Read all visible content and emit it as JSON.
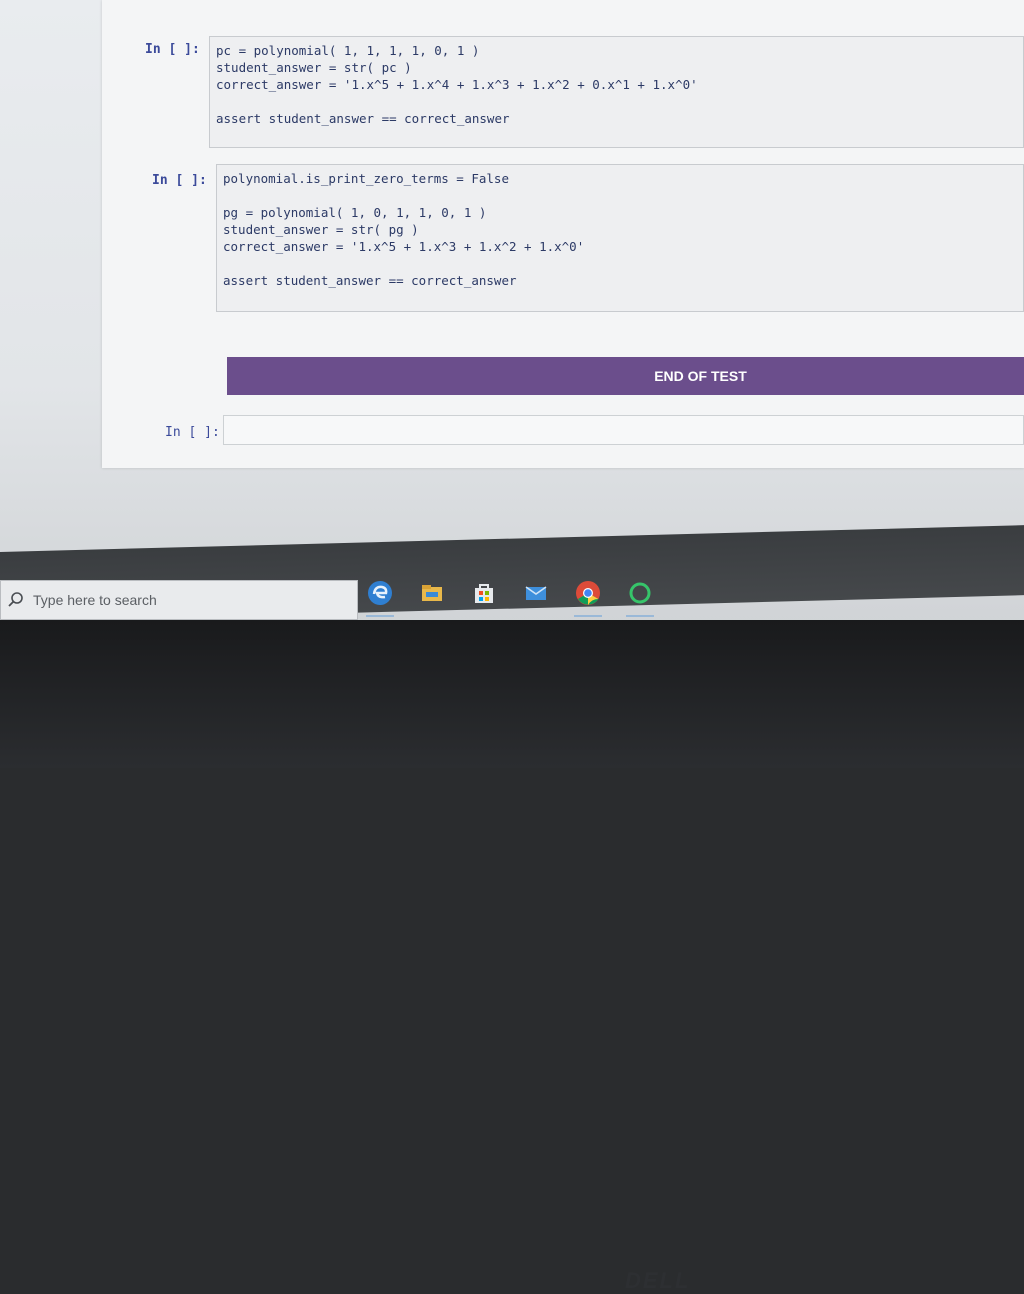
{
  "notebook": {
    "cells": [
      {
        "prompt": "In [ ]:",
        "lines": [
          "pc = polynomial( 1, 1, 1, 1, 0, 1 )",
          "student_answer = str( pc )",
          "correct_answer = '1.x^5 + 1.x^4 + 1.x^3 + 1.x^2 + 0.x^1 + 1.x^0'",
          "",
          "assert student_answer == correct_answer"
        ]
      },
      {
        "prompt": "In [ ]:",
        "lines": [
          "polynomial.is_print_zero_terms = False",
          "",
          "pg = polynomial( 1, 0, 1, 1, 0, 1 )",
          "student_answer = str( pg )",
          "correct_answer = '1.x^5 + 1.x^3 + 1.x^2 + 1.x^0'",
          "",
          "assert student_answer == correct_answer"
        ]
      }
    ],
    "end_banner": "END OF TEST",
    "empty_cell_prompt": "In [ ]:"
  },
  "taskbar": {
    "search_placeholder": "Type here to search",
    "apps": [
      {
        "icon": "edge-icon",
        "color": "#2f7fd1",
        "active": true
      },
      {
        "icon": "file-explorer-icon",
        "color": "#e8b84a",
        "active": false
      },
      {
        "icon": "store-icon",
        "color": "#3a8ad6",
        "active": false
      },
      {
        "icon": "mail-icon",
        "color": "#3e8fdc",
        "active": false
      },
      {
        "icon": "chrome-icon",
        "color": "#dd4b39",
        "active": true
      },
      {
        "icon": "cortana-ring-icon",
        "color": "#36c46a",
        "active": true
      }
    ]
  },
  "device": {
    "brand": "DELL"
  }
}
